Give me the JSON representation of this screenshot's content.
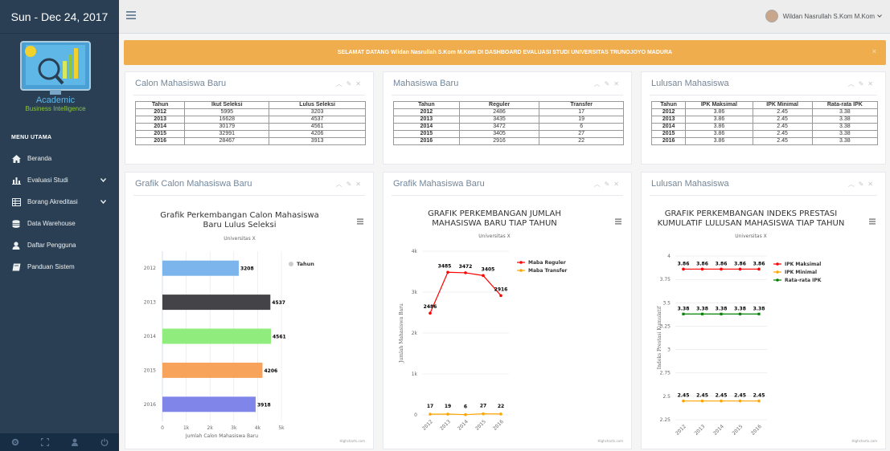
{
  "sidebar": {
    "date": "Sun - Dec 24, 2017",
    "logo_text": "Academic",
    "logo_sub": "Business Intelligence",
    "section_title": "MENU UTAMA",
    "items": [
      {
        "label": "Beranda",
        "icon": "home-icon"
      },
      {
        "label": "Evaluasi Studi",
        "icon": "bar-chart-icon",
        "has_dropdown": true
      },
      {
        "label": "Borang Akreditasi",
        "icon": "table-icon",
        "has_dropdown": true
      },
      {
        "label": "Data Warehouse",
        "icon": "database-icon"
      },
      {
        "label": "Daftar Pengguna",
        "icon": "user-icon"
      },
      {
        "label": "Panduan Sistem",
        "icon": "book-icon"
      }
    ],
    "footer_icons": [
      "settings-icon",
      "fullscreen-icon",
      "lock-icon",
      "power-icon"
    ]
  },
  "topbar": {
    "user_name": "Wildan Nasrullah S.Kom M.Kom"
  },
  "alert": {
    "message": "SELAMAT DATANG Wildan Nasrullah S.Kom M.Kom DI DASHBOARD EVALUASI STUDI UNIVERSITAS TRUNOJOYO MADURA",
    "close": "×"
  },
  "panels": {
    "calon": {
      "title": "Calon Mahasiswa Baru",
      "headers": [
        "Tahun",
        "Ikut Seleksi",
        "Lulus Seleksi"
      ],
      "rows": [
        [
          "2012",
          "5995",
          "3203"
        ],
        [
          "2013",
          "16628",
          "4537"
        ],
        [
          "2014",
          "30179",
          "4561"
        ],
        [
          "2015",
          "32991",
          "4206"
        ],
        [
          "2016",
          "28467",
          "3913"
        ]
      ]
    },
    "maba": {
      "title": "Mahasiswa Baru",
      "headers": [
        "Tahun",
        "Reguler",
        "Transfer"
      ],
      "rows": [
        [
          "2012",
          "2486",
          "17"
        ],
        [
          "2013",
          "3435",
          "19"
        ],
        [
          "2014",
          "3472",
          "6"
        ],
        [
          "2015",
          "3405",
          "27"
        ],
        [
          "2016",
          "2916",
          "22"
        ]
      ]
    },
    "lulusan": {
      "title": "Lulusan Mahasiswa",
      "headers": [
        "Tahun",
        "IPK Maksimal",
        "IPK Minimal",
        "Rata-rata IPK"
      ],
      "rows": [
        [
          "2012",
          "3.86",
          "2.45",
          "3.38"
        ],
        [
          "2013",
          "3.86",
          "2.45",
          "3.38"
        ],
        [
          "2014",
          "3.86",
          "2.45",
          "3.38"
        ],
        [
          "2015",
          "3.86",
          "2.45",
          "3.38"
        ],
        [
          "2016",
          "3.86",
          "2.45",
          "3.38"
        ]
      ]
    },
    "grafik_calon_title": "Grafik Calon Mahasiswa Baru",
    "grafik_maba_title": "Grafik Mahasiswa Baru",
    "grafik_lulusan_title": "Lulusan Mahasiswa",
    "credits": "Highcharts.com"
  },
  "chart_data": [
    {
      "type": "bar",
      "title": "Grafik Perkembangan Calon Mahasiswa Baru Lulus Seleksi",
      "subtitle": "Universitas X",
      "categories": [
        "2012",
        "2013",
        "2014",
        "2015",
        "2016"
      ],
      "values": [
        3208,
        4537,
        4561,
        4206,
        3918
      ],
      "labels": [
        "3208",
        "4537",
        "4561",
        "4206",
        "3918"
      ],
      "colors": [
        "#7cb5ec",
        "#434348",
        "#90ed7d",
        "#f7a35c",
        "#8085e9"
      ],
      "xlabel": "Jumlah Calon Mahasiswa Baru",
      "xlim": [
        0,
        5000
      ],
      "ticks": [
        "0",
        "1k",
        "2k",
        "3k",
        "4k",
        "5k"
      ],
      "legend": [
        "Tahun"
      ],
      "legend_position": "right"
    },
    {
      "type": "line",
      "title": "GRAFIK PERKEMBANGAN JUMLAH MAHASISWA BARU TIAP TAHUN",
      "subtitle": "Universitas X",
      "x": [
        "2012",
        "2013",
        "2014",
        "2015",
        "2016"
      ],
      "ylabel": "Jumlah Mahasiswa Baru",
      "ylim": [
        0,
        4000
      ],
      "ticks": [
        "0",
        "1k",
        "2k",
        "3k",
        "4k"
      ],
      "series": [
        {
          "name": "Maba Reguler",
          "color": "#ff0000",
          "values": [
            2486,
            3485,
            3472,
            3405,
            2916
          ]
        },
        {
          "name": "Maba Transfer",
          "color": "#ffa500",
          "values": [
            17,
            19,
            6,
            27,
            22
          ]
        }
      ],
      "legend_position": "right"
    },
    {
      "type": "line",
      "title": "GRAFIK PERKEMBANGAN INDEKS PRESTASI KUMULATIF LULUSAN MAHASISWA TIAP TAHUN",
      "subtitle": "Universitas X",
      "x": [
        "2012",
        "2013",
        "2014",
        "2015",
        "2016"
      ],
      "ylabel": "Indeks Prestasi Kumulatif",
      "ylim": [
        2.25,
        4
      ],
      "ticks": [
        "2.25",
        "2.5",
        "2.75",
        "3",
        "3.25",
        "3.5",
        "3.75",
        "4"
      ],
      "series": [
        {
          "name": "IPK Maksimal",
          "color": "#ff0000",
          "values": [
            3.86,
            3.86,
            3.86,
            3.86,
            3.86
          ]
        },
        {
          "name": "IPK Minimal",
          "color": "#ffa500",
          "values": [
            2.45,
            2.45,
            2.45,
            2.45,
            2.45
          ]
        },
        {
          "name": "Rata-rata IPK",
          "color": "#008000",
          "values": [
            3.38,
            3.38,
            3.38,
            3.38,
            3.38
          ]
        }
      ],
      "legend_position": "right"
    }
  ]
}
